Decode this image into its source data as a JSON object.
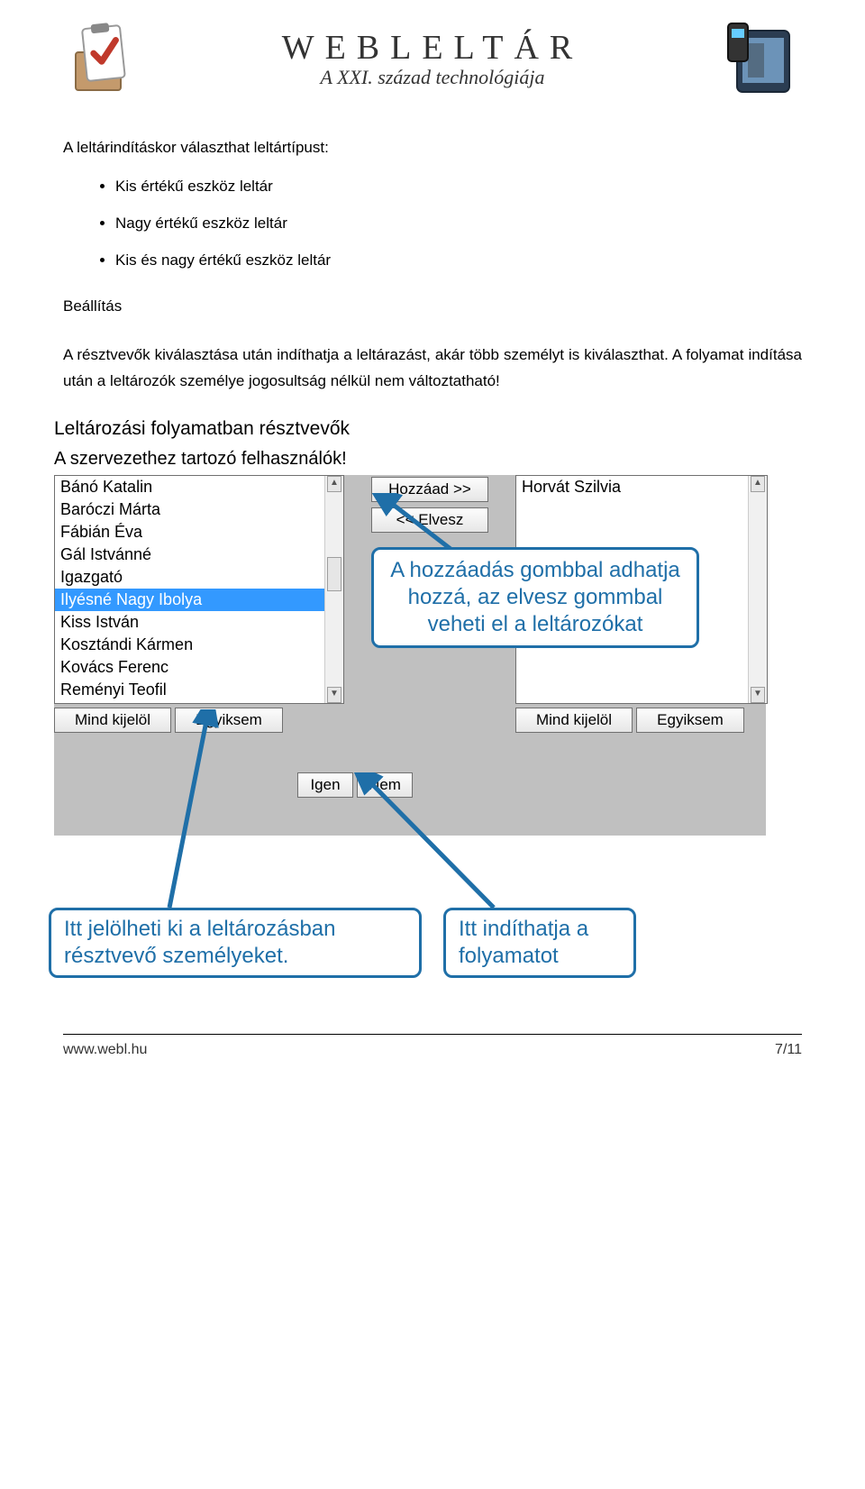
{
  "header": {
    "main_title": "WEBLELTÁR",
    "subtitle": "A XXI. század technológiája"
  },
  "intro": {
    "lead": "A leltárindításkor választhat leltártípust:",
    "bullets": [
      "Kis értékű eszköz leltár",
      "Nagy értékű eszköz leltár",
      "Kis és nagy értékű eszköz leltár"
    ],
    "section_label": "Beállítás",
    "paragraph": "A résztvevők kiválasztása után indíthatja a leltárazást, akár több személyt is kiválaszthat. A folyamat indítása után a leltározók személye jogosultság nélkül nem változtatható!"
  },
  "screenshot": {
    "heading1": "Leltározási folyamatban résztvevők",
    "heading2": "A szervezethez tartozó felhasználók!",
    "available_users": [
      "Bánó Katalin",
      "Baróczi Márta",
      "Fábián Éva",
      "Gál Istvánné",
      "Igazgató",
      "Ilyésné Nagy Ibolya",
      "Kiss István",
      "Kosztándi Kármen",
      "Kovács Ferenc",
      "Reményi Teofil"
    ],
    "selected_index": 5,
    "assigned_users": [
      "Horvát Szilvia"
    ],
    "btn_add": "Hozzáad >>",
    "btn_remove": "<< Elvesz",
    "btn_select_all": "Mind kijelöl",
    "btn_select_none": "Egyiksem",
    "btn_yes": "Igen",
    "btn_no": "Nem",
    "callout_main": "A hozzáadás gombbal adhatja hozzá, az elvesz gommbal veheti el a leltározókat",
    "callout_left": "Itt jelölheti ki a leltározásban résztvevő személyeket.",
    "callout_right": "Itt indíthatja a folyamatot"
  },
  "footer": {
    "url": "www.webl.hu",
    "page": "7/11"
  }
}
